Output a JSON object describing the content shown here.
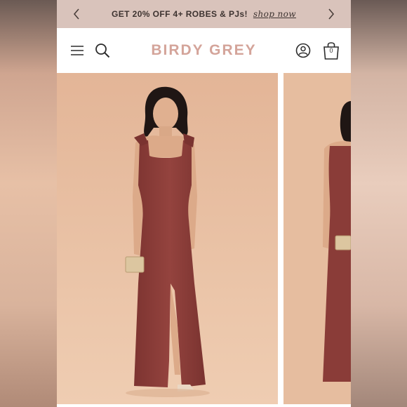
{
  "promo": {
    "text": "GET 20% OFF 4+ ROBES & PJs!",
    "link": "shop now"
  },
  "header": {
    "brand": "BIRDY GREY",
    "cart_count": "0"
  },
  "icons": {
    "left_arrow": "chevron-left-icon",
    "right_arrow": "chevron-right-icon",
    "menu": "menu-icon",
    "search": "search-icon",
    "account": "account-icon",
    "bag": "shopping-bag-icon"
  },
  "colors": {
    "promo_bg": "#d9c3bb",
    "brand": "#d4a49a",
    "photo_bg": "#e5bc9e",
    "dress": "#8e3f3a"
  }
}
